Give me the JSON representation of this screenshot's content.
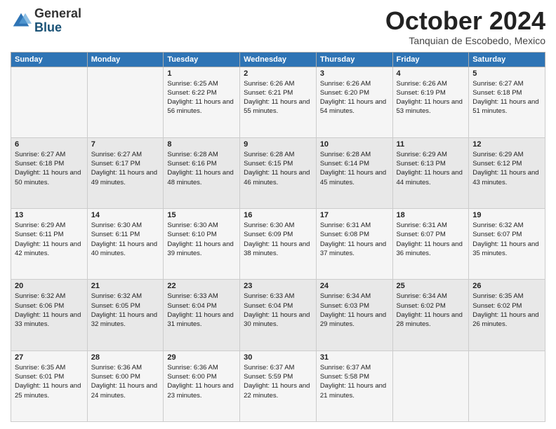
{
  "logo": {
    "general": "General",
    "blue": "Blue"
  },
  "header": {
    "month": "October 2024",
    "location": "Tanquian de Escobedo, Mexico"
  },
  "weekdays": [
    "Sunday",
    "Monday",
    "Tuesday",
    "Wednesday",
    "Thursday",
    "Friday",
    "Saturday"
  ],
  "weeks": [
    [
      {
        "day": "",
        "info": ""
      },
      {
        "day": "",
        "info": ""
      },
      {
        "day": "1",
        "info": "Sunrise: 6:25 AM\nSunset: 6:22 PM\nDaylight: 11 hours and 56 minutes."
      },
      {
        "day": "2",
        "info": "Sunrise: 6:26 AM\nSunset: 6:21 PM\nDaylight: 11 hours and 55 minutes."
      },
      {
        "day": "3",
        "info": "Sunrise: 6:26 AM\nSunset: 6:20 PM\nDaylight: 11 hours and 54 minutes."
      },
      {
        "day": "4",
        "info": "Sunrise: 6:26 AM\nSunset: 6:19 PM\nDaylight: 11 hours and 53 minutes."
      },
      {
        "day": "5",
        "info": "Sunrise: 6:27 AM\nSunset: 6:18 PM\nDaylight: 11 hours and 51 minutes."
      }
    ],
    [
      {
        "day": "6",
        "info": "Sunrise: 6:27 AM\nSunset: 6:18 PM\nDaylight: 11 hours and 50 minutes."
      },
      {
        "day": "7",
        "info": "Sunrise: 6:27 AM\nSunset: 6:17 PM\nDaylight: 11 hours and 49 minutes."
      },
      {
        "day": "8",
        "info": "Sunrise: 6:28 AM\nSunset: 6:16 PM\nDaylight: 11 hours and 48 minutes."
      },
      {
        "day": "9",
        "info": "Sunrise: 6:28 AM\nSunset: 6:15 PM\nDaylight: 11 hours and 46 minutes."
      },
      {
        "day": "10",
        "info": "Sunrise: 6:28 AM\nSunset: 6:14 PM\nDaylight: 11 hours and 45 minutes."
      },
      {
        "day": "11",
        "info": "Sunrise: 6:29 AM\nSunset: 6:13 PM\nDaylight: 11 hours and 44 minutes."
      },
      {
        "day": "12",
        "info": "Sunrise: 6:29 AM\nSunset: 6:12 PM\nDaylight: 11 hours and 43 minutes."
      }
    ],
    [
      {
        "day": "13",
        "info": "Sunrise: 6:29 AM\nSunset: 6:11 PM\nDaylight: 11 hours and 42 minutes."
      },
      {
        "day": "14",
        "info": "Sunrise: 6:30 AM\nSunset: 6:11 PM\nDaylight: 11 hours and 40 minutes."
      },
      {
        "day": "15",
        "info": "Sunrise: 6:30 AM\nSunset: 6:10 PM\nDaylight: 11 hours and 39 minutes."
      },
      {
        "day": "16",
        "info": "Sunrise: 6:30 AM\nSunset: 6:09 PM\nDaylight: 11 hours and 38 minutes."
      },
      {
        "day": "17",
        "info": "Sunrise: 6:31 AM\nSunset: 6:08 PM\nDaylight: 11 hours and 37 minutes."
      },
      {
        "day": "18",
        "info": "Sunrise: 6:31 AM\nSunset: 6:07 PM\nDaylight: 11 hours and 36 minutes."
      },
      {
        "day": "19",
        "info": "Sunrise: 6:32 AM\nSunset: 6:07 PM\nDaylight: 11 hours and 35 minutes."
      }
    ],
    [
      {
        "day": "20",
        "info": "Sunrise: 6:32 AM\nSunset: 6:06 PM\nDaylight: 11 hours and 33 minutes."
      },
      {
        "day": "21",
        "info": "Sunrise: 6:32 AM\nSunset: 6:05 PM\nDaylight: 11 hours and 32 minutes."
      },
      {
        "day": "22",
        "info": "Sunrise: 6:33 AM\nSunset: 6:04 PM\nDaylight: 11 hours and 31 minutes."
      },
      {
        "day": "23",
        "info": "Sunrise: 6:33 AM\nSunset: 6:04 PM\nDaylight: 11 hours and 30 minutes."
      },
      {
        "day": "24",
        "info": "Sunrise: 6:34 AM\nSunset: 6:03 PM\nDaylight: 11 hours and 29 minutes."
      },
      {
        "day": "25",
        "info": "Sunrise: 6:34 AM\nSunset: 6:02 PM\nDaylight: 11 hours and 28 minutes."
      },
      {
        "day": "26",
        "info": "Sunrise: 6:35 AM\nSunset: 6:02 PM\nDaylight: 11 hours and 26 minutes."
      }
    ],
    [
      {
        "day": "27",
        "info": "Sunrise: 6:35 AM\nSunset: 6:01 PM\nDaylight: 11 hours and 25 minutes."
      },
      {
        "day": "28",
        "info": "Sunrise: 6:36 AM\nSunset: 6:00 PM\nDaylight: 11 hours and 24 minutes."
      },
      {
        "day": "29",
        "info": "Sunrise: 6:36 AM\nSunset: 6:00 PM\nDaylight: 11 hours and 23 minutes."
      },
      {
        "day": "30",
        "info": "Sunrise: 6:37 AM\nSunset: 5:59 PM\nDaylight: 11 hours and 22 minutes."
      },
      {
        "day": "31",
        "info": "Sunrise: 6:37 AM\nSunset: 5:58 PM\nDaylight: 11 hours and 21 minutes."
      },
      {
        "day": "",
        "info": ""
      },
      {
        "day": "",
        "info": ""
      }
    ]
  ]
}
